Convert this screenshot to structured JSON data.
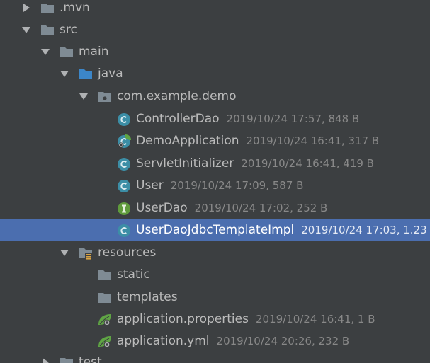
{
  "colors": {
    "background": "#3c3f41",
    "selection": "#4b6eaf",
    "text": "#bbbbbb",
    "meta_text": "#888888",
    "folder": "#7f8b94",
    "source_folder": "#3c86c8",
    "class_icon": "#3c8ea6",
    "interface_icon": "#5f9b3c",
    "spring_leaf": "#5fa544"
  },
  "tree": {
    "mvn": {
      "name": ".mvn",
      "icon": "folder-icon",
      "expanded": false
    },
    "src": {
      "name": "src",
      "icon": "folder-icon",
      "expanded": true
    },
    "main": {
      "name": "main",
      "icon": "folder-icon",
      "expanded": true
    },
    "java": {
      "name": "java",
      "icon": "source-folder-icon",
      "expanded": true
    },
    "package": {
      "name": "com.example.demo",
      "icon": "package-icon",
      "expanded": true
    },
    "controller_dao": {
      "name": "ControllerDao",
      "meta": "2019/10/24 17:57, 848 B",
      "icon": "class-icon"
    },
    "demo_application": {
      "name": "DemoApplication",
      "meta": "2019/10/24 16:41, 317 B",
      "icon": "spring-boot-class-icon"
    },
    "servlet_initializer": {
      "name": "ServletInitializer",
      "meta": "2019/10/24 16:41, 419 B",
      "icon": "class-icon"
    },
    "user": {
      "name": "User",
      "meta": "2019/10/24 17:09, 587 B",
      "icon": "class-icon"
    },
    "user_dao": {
      "name": "UserDao",
      "meta": "2019/10/24 17:02, 252 B",
      "icon": "interface-icon"
    },
    "user_dao_impl": {
      "name": "UserDaoJdbcTemplateImpl",
      "meta": "2019/10/24 17:03, 1.23",
      "icon": "class-icon",
      "selected": true
    },
    "resources": {
      "name": "resources",
      "icon": "resources-folder-icon",
      "expanded": true
    },
    "static": {
      "name": "static",
      "icon": "folder-icon"
    },
    "templates": {
      "name": "templates",
      "icon": "folder-icon"
    },
    "app_properties": {
      "name": "application.properties",
      "meta": "2019/10/24 16:41, 1 B",
      "icon": "spring-config-icon"
    },
    "app_yml": {
      "name": "application.yml",
      "meta": "2019/10/24 20:26, 232 B",
      "icon": "spring-config-icon"
    },
    "test": {
      "name": "test",
      "icon": "folder-icon",
      "expanded": false
    }
  }
}
